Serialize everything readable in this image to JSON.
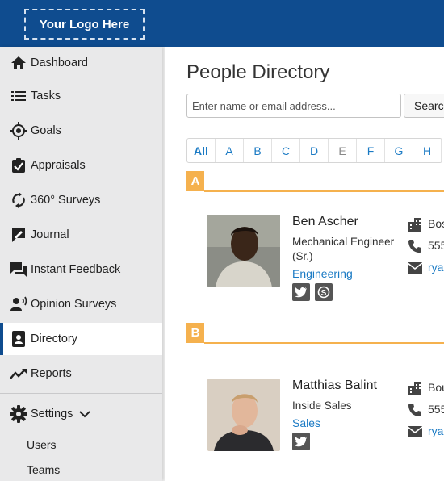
{
  "header": {
    "logo_text": "Your Logo Here"
  },
  "sidebar": {
    "items": [
      {
        "label": "Dashboard",
        "icon": "home-icon"
      },
      {
        "label": "Tasks",
        "icon": "list-icon"
      },
      {
        "label": "Goals",
        "icon": "target-icon"
      },
      {
        "label": "Appraisals",
        "icon": "checkbox-clipboard-icon"
      },
      {
        "label": "360° Surveys",
        "icon": "sync-arrows-icon"
      },
      {
        "label": "Journal",
        "icon": "journal-pen-icon"
      },
      {
        "label": "Instant Feedback",
        "icon": "chat-bubbles-icon"
      },
      {
        "label": "Opinion Surveys",
        "icon": "person-speaking-icon"
      },
      {
        "label": "Directory",
        "icon": "contacts-book-icon",
        "active": true
      },
      {
        "label": "Reports",
        "icon": "trend-line-icon"
      }
    ],
    "settings": {
      "label": "Settings",
      "icon": "gear-icon",
      "expand_icon": "chevron-down-icon"
    },
    "sub_items": [
      "Users",
      "Teams"
    ]
  },
  "main": {
    "title": "People Directory",
    "search": {
      "placeholder": "Enter name or email address...",
      "button_label": "Search"
    },
    "letters": [
      {
        "label": "All",
        "state": "selected"
      },
      {
        "label": "A",
        "state": "enabled"
      },
      {
        "label": "B",
        "state": "enabled"
      },
      {
        "label": "C",
        "state": "enabled"
      },
      {
        "label": "D",
        "state": "enabled"
      },
      {
        "label": "E",
        "state": "disabled"
      },
      {
        "label": "F",
        "state": "enabled"
      },
      {
        "label": "G",
        "state": "enabled"
      },
      {
        "label": "H",
        "state": "enabled"
      }
    ],
    "sections": [
      {
        "letter": "A",
        "person": {
          "name": "Ben Ascher",
          "title": "Mechanical Engineer (Sr.)",
          "department": "Engineering",
          "social": [
            "twitter-icon",
            "skype-icon"
          ],
          "location": "Bos",
          "phone": "555",
          "email": "rya"
        }
      },
      {
        "letter": "B",
        "person": {
          "name": "Matthias Balint",
          "title": "Inside Sales",
          "department": "Sales",
          "social": [
            "twitter-icon"
          ],
          "location": "Bou",
          "phone": "555",
          "email": "rya"
        }
      }
    ]
  },
  "colors": {
    "header_bg": "#0f4c8f",
    "sidebar_bg": "#e9e9ea",
    "accent_orange": "#f5b14e",
    "link_blue": "#1a7ac4"
  }
}
